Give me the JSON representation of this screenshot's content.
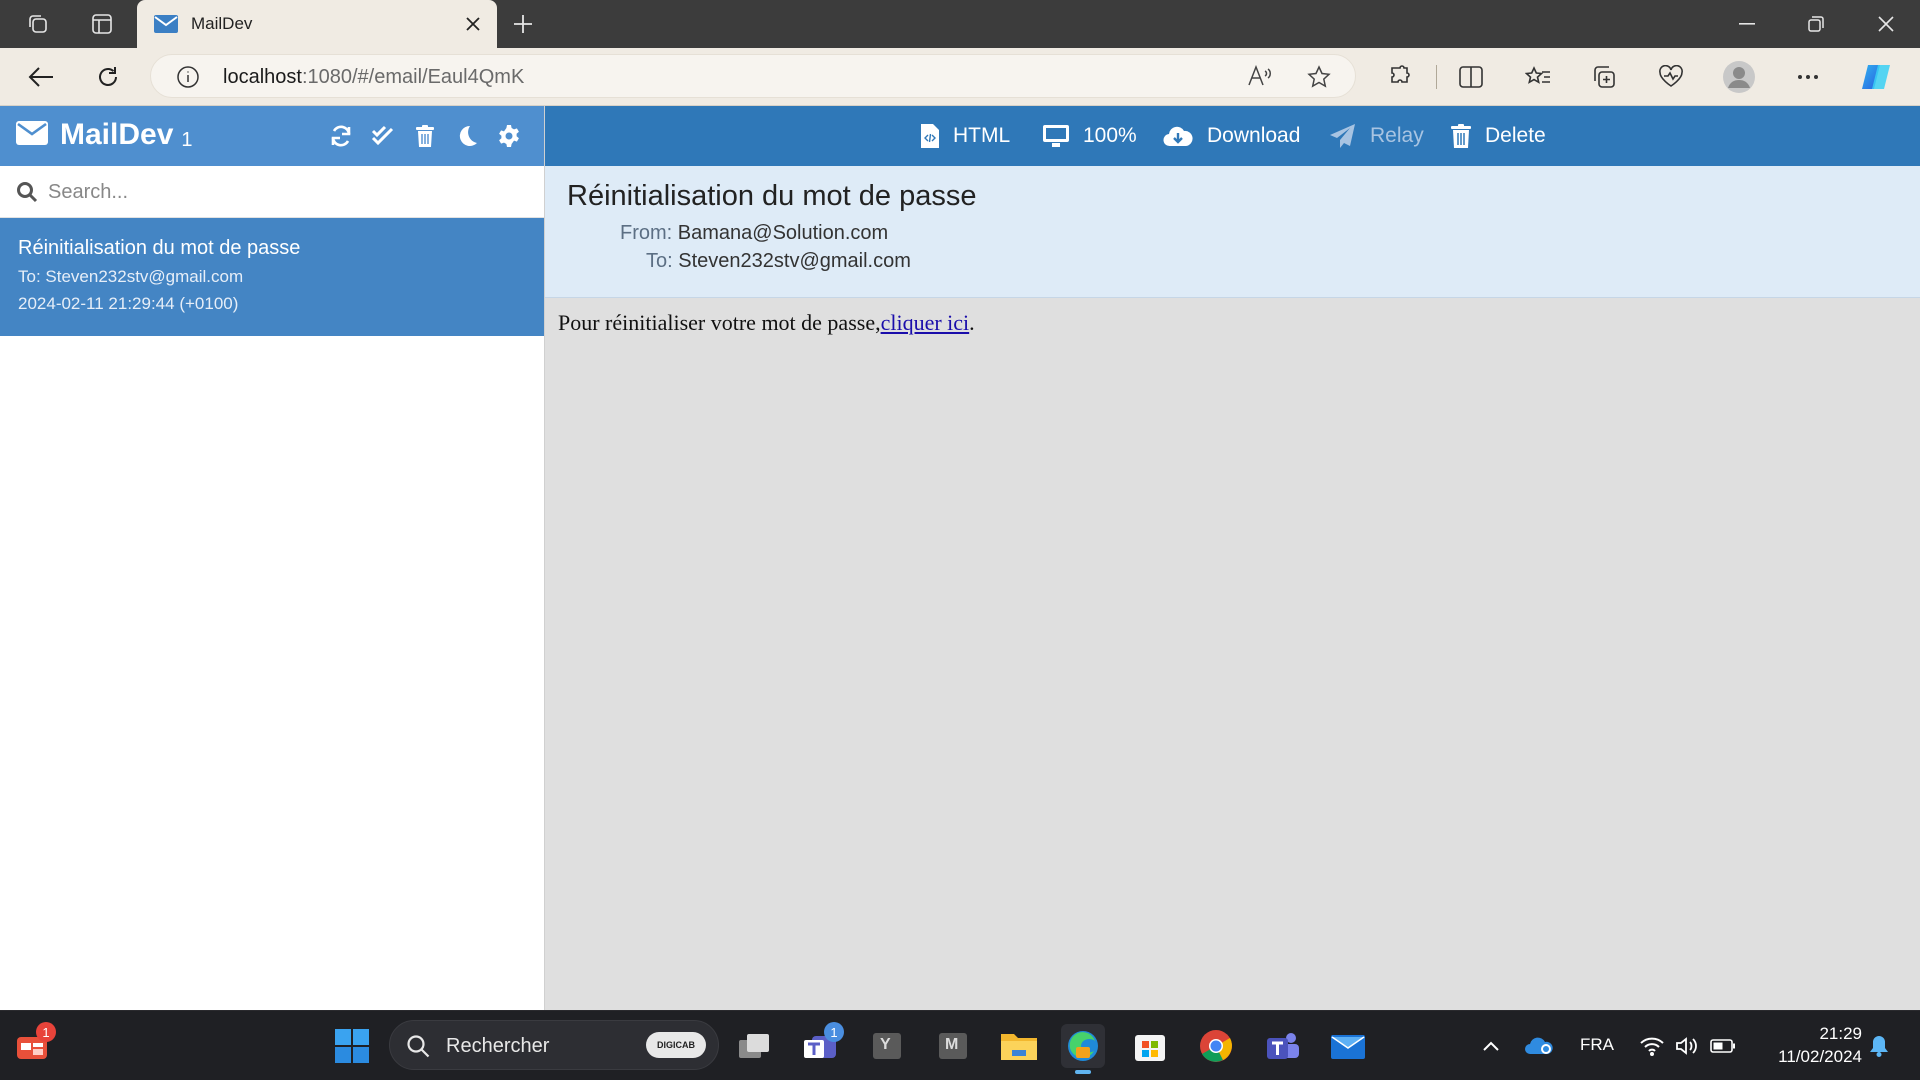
{
  "browser": {
    "tab_title": "MailDev",
    "url_host": "localhost",
    "url_path": ":1080/#/email/Eaul4QmK"
  },
  "sidebar": {
    "app_name": "MailDev",
    "unread_count": "1",
    "search_placeholder": "Search...",
    "emails": [
      {
        "subject": "Réinitialisation du mot de passe",
        "to": "To: Steven232stv@gmail.com",
        "date": "2024-02-11 21:29:44 (+0100)"
      }
    ]
  },
  "toolbar": {
    "html_label": "HTML",
    "zoom_label": "100%",
    "download_label": "Download",
    "relay_label": "Relay",
    "delete_label": "Delete"
  },
  "email": {
    "subject": "Réinitialisation du mot de passe",
    "from_label": "From:",
    "from": "Bamana@Solution.com",
    "to_label": "To:",
    "to": "Steven232stv@gmail.com",
    "body_text": "Pour réinitialiser votre mot de passe,",
    "body_link": "cliquer ici",
    "body_end": "."
  },
  "taskbar": {
    "search_text": "Rechercher",
    "search_chip": "DIGICAB",
    "notification_badge": "1",
    "teams_badge": "1",
    "app_y_label": "Y",
    "app_m_label": "M",
    "language": "FRA",
    "time": "21:29",
    "date": "11/02/2024"
  },
  "colors": {
    "sidebar_header": "#4f8fcf",
    "toolbar": "#2f78b8",
    "selected_item": "#4485c4",
    "email_header_bg": "#deebf7"
  }
}
